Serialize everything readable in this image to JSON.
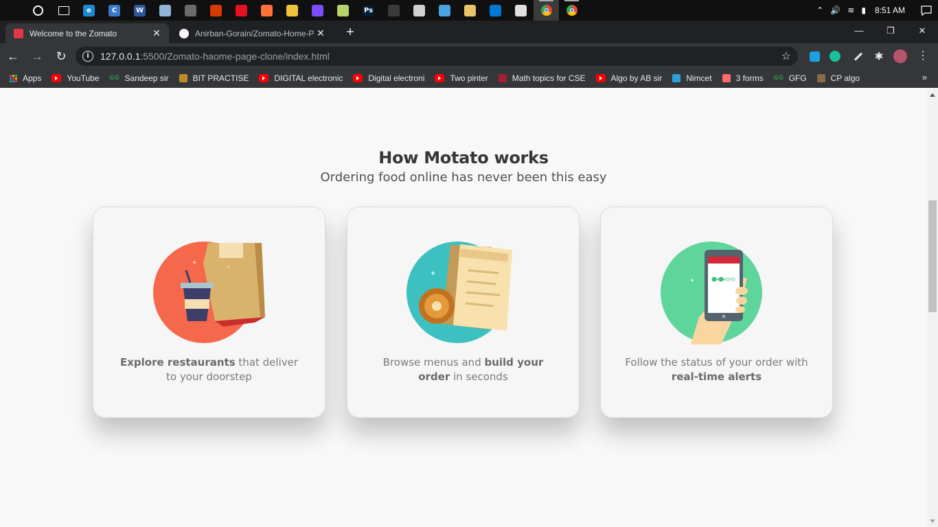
{
  "taskbar": {
    "time": "8:51 AM",
    "apps": [
      {
        "name": "windows-start",
        "label": "",
        "color": "#ffffff"
      },
      {
        "name": "cortana",
        "label": "",
        "color": "#ffffff"
      },
      {
        "name": "task-view",
        "label": "",
        "color": "#ffffff"
      },
      {
        "name": "edge",
        "label": "e",
        "color": "#1a8ad4"
      },
      {
        "name": "dev-c",
        "label": "C",
        "color": "#3c78c8"
      },
      {
        "name": "word",
        "label": "W",
        "color": "#2b579a"
      },
      {
        "name": "notepad",
        "label": "",
        "color": "#8fb4d8"
      },
      {
        "name": "calculator",
        "label": "",
        "color": "#6b6b6b"
      },
      {
        "name": "store",
        "label": "",
        "color": "#d83b01"
      },
      {
        "name": "target-app",
        "label": "",
        "color": "#e81123"
      },
      {
        "name": "firefox",
        "label": "",
        "color": "#ff7139"
      },
      {
        "name": "file-explorer",
        "label": "",
        "color": "#f0c33c"
      },
      {
        "name": "drop-app",
        "label": "",
        "color": "#7c4dff"
      },
      {
        "name": "sticky-notes",
        "label": "",
        "color": "#b9d36c"
      },
      {
        "name": "photoshop",
        "label": "Ps",
        "color": "#001e36"
      },
      {
        "name": "git",
        "label": "",
        "color": "#3a3a3a"
      },
      {
        "name": "clock-app",
        "label": "",
        "color": "#d0d0d0"
      },
      {
        "name": "paint",
        "label": "",
        "color": "#4aa3df"
      },
      {
        "name": "photos",
        "label": "",
        "color": "#e8c46a"
      },
      {
        "name": "vscode",
        "label": "",
        "color": "#0078d4"
      },
      {
        "name": "feedback",
        "label": "",
        "color": "#e0e0e0"
      },
      {
        "name": "chrome-1",
        "label": "",
        "color": "#4285f4"
      },
      {
        "name": "chrome-2",
        "label": "",
        "color": "#4285f4"
      }
    ]
  },
  "tabs": [
    {
      "title": "Welcome to the Zomato",
      "favicon_color": "#e23744"
    },
    {
      "title": "Anirban-Gorain/Zomato-Home-P",
      "favicon_color": "#ffffff"
    }
  ],
  "url": {
    "host": "127.0.0.1",
    "rest": ":5500/Zomato-haome-page-clone/index.html"
  },
  "bookmarks": [
    {
      "label": "Apps",
      "icon": "apps-grid-icon",
      "color": "#e8a33d"
    },
    {
      "label": "YouTube",
      "icon": "youtube-icon",
      "color": "#ff0000"
    },
    {
      "label": "Sandeep sir",
      "icon": "gfg-icon",
      "color": "#2f8d46"
    },
    {
      "label": "BIT PRACTISE",
      "icon": "bit-icon",
      "color": "#c08a2a"
    },
    {
      "label": "DIGITAL electronic",
      "icon": "youtube-icon",
      "color": "#ff0000"
    },
    {
      "label": "Digital electroni",
      "icon": "youtube-icon",
      "color": "#ff0000"
    },
    {
      "label": "Two pinter",
      "icon": "youtube-icon",
      "color": "#ff0000"
    },
    {
      "label": "Math topics for CSE",
      "icon": "mit-icon",
      "color": "#a31f34"
    },
    {
      "label": "Algo by AB sir",
      "icon": "youtube-icon",
      "color": "#ff0000"
    },
    {
      "label": "Nimcet",
      "icon": "nimcet-icon",
      "color": "#2b9fd8"
    },
    {
      "label": "3 forms",
      "icon": "forms-icon",
      "color": "#ff6a6a"
    },
    {
      "label": "GFG",
      "icon": "gfg-icon",
      "color": "#2f8d46"
    },
    {
      "label": "CP algo",
      "icon": "cp-algo-icon",
      "color": "#8b6a4a"
    }
  ],
  "main": {
    "title": "How Motato works",
    "subtitle": "Ordering food online has never been this easy",
    "cards": [
      {
        "bold1": "Explore restaurants",
        "text1": " that deliver to your doorstep",
        "bold2": "",
        "text2": ""
      },
      {
        "text0": "Browse menus and ",
        "bold1": "build your order",
        "text1": " in seconds"
      },
      {
        "text0": "Follow the status of your order with ",
        "bold1": "real-time alerts",
        "text1": ""
      }
    ]
  },
  "colors": {
    "brand_red": "#e23744",
    "card1_circle": "#f6684c",
    "card2_circle": "#3cc0c0",
    "card3_circle": "#5ed59b"
  }
}
